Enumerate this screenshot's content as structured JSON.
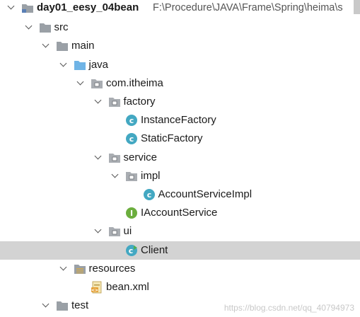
{
  "project": {
    "name": "day01_eesy_04bean",
    "path": "F:\\Procedure\\JAVA\\Frame\\Spring\\heima\\s"
  },
  "tree": [
    {
      "id": "project-root",
      "label": "day01_eesy_04bean",
      "level": 0,
      "icon": "module-folder-icon",
      "expanded": true
    },
    {
      "id": "src",
      "label": "src",
      "level": 1,
      "icon": "folder-icon",
      "expanded": true
    },
    {
      "id": "main",
      "label": "main",
      "level": 2,
      "icon": "folder-icon",
      "expanded": true
    },
    {
      "id": "java",
      "label": "java",
      "level": 3,
      "icon": "source-root-icon",
      "expanded": true
    },
    {
      "id": "com-itheima",
      "label": "com.itheima",
      "level": 4,
      "icon": "package-icon",
      "expanded": true
    },
    {
      "id": "factory",
      "label": "factory",
      "level": 5,
      "icon": "package-icon",
      "expanded": true
    },
    {
      "id": "instance-factory",
      "label": "InstanceFactory",
      "level": 6,
      "icon": "class-icon"
    },
    {
      "id": "static-factory",
      "label": "StaticFactory",
      "level": 6,
      "icon": "class-icon"
    },
    {
      "id": "service",
      "label": "service",
      "level": 5,
      "icon": "package-icon",
      "expanded": true
    },
    {
      "id": "impl",
      "label": "impl",
      "level": 6,
      "icon": "package-icon",
      "expanded": true
    },
    {
      "id": "account-service-impl",
      "label": "AccountServiceImpl",
      "level": 7,
      "icon": "class-icon"
    },
    {
      "id": "iaccount-service",
      "label": "IAccountService",
      "level": 6,
      "icon": "interface-icon"
    },
    {
      "id": "ui",
      "label": "ui",
      "level": 5,
      "icon": "package-icon",
      "expanded": true
    },
    {
      "id": "client",
      "label": "Client",
      "level": 6,
      "icon": "runnable-class-icon",
      "selected": true
    },
    {
      "id": "resources",
      "label": "resources",
      "level": 3,
      "icon": "resources-root-icon",
      "expanded": true
    },
    {
      "id": "bean-xml",
      "label": "bean.xml",
      "level": 4,
      "icon": "xml-file-icon"
    },
    {
      "id": "test",
      "label": "test",
      "level": 2,
      "icon": "folder-icon",
      "expanded": true
    }
  ],
  "watermark": "https://blog.csdn.net/qq_40794973",
  "colors": {
    "selection": "#d3d3d3",
    "class_icon": "#43a8c2",
    "interface_icon": "#6cae3e",
    "folder": "#9aa0a6",
    "source_root": "#6fb4e6"
  }
}
